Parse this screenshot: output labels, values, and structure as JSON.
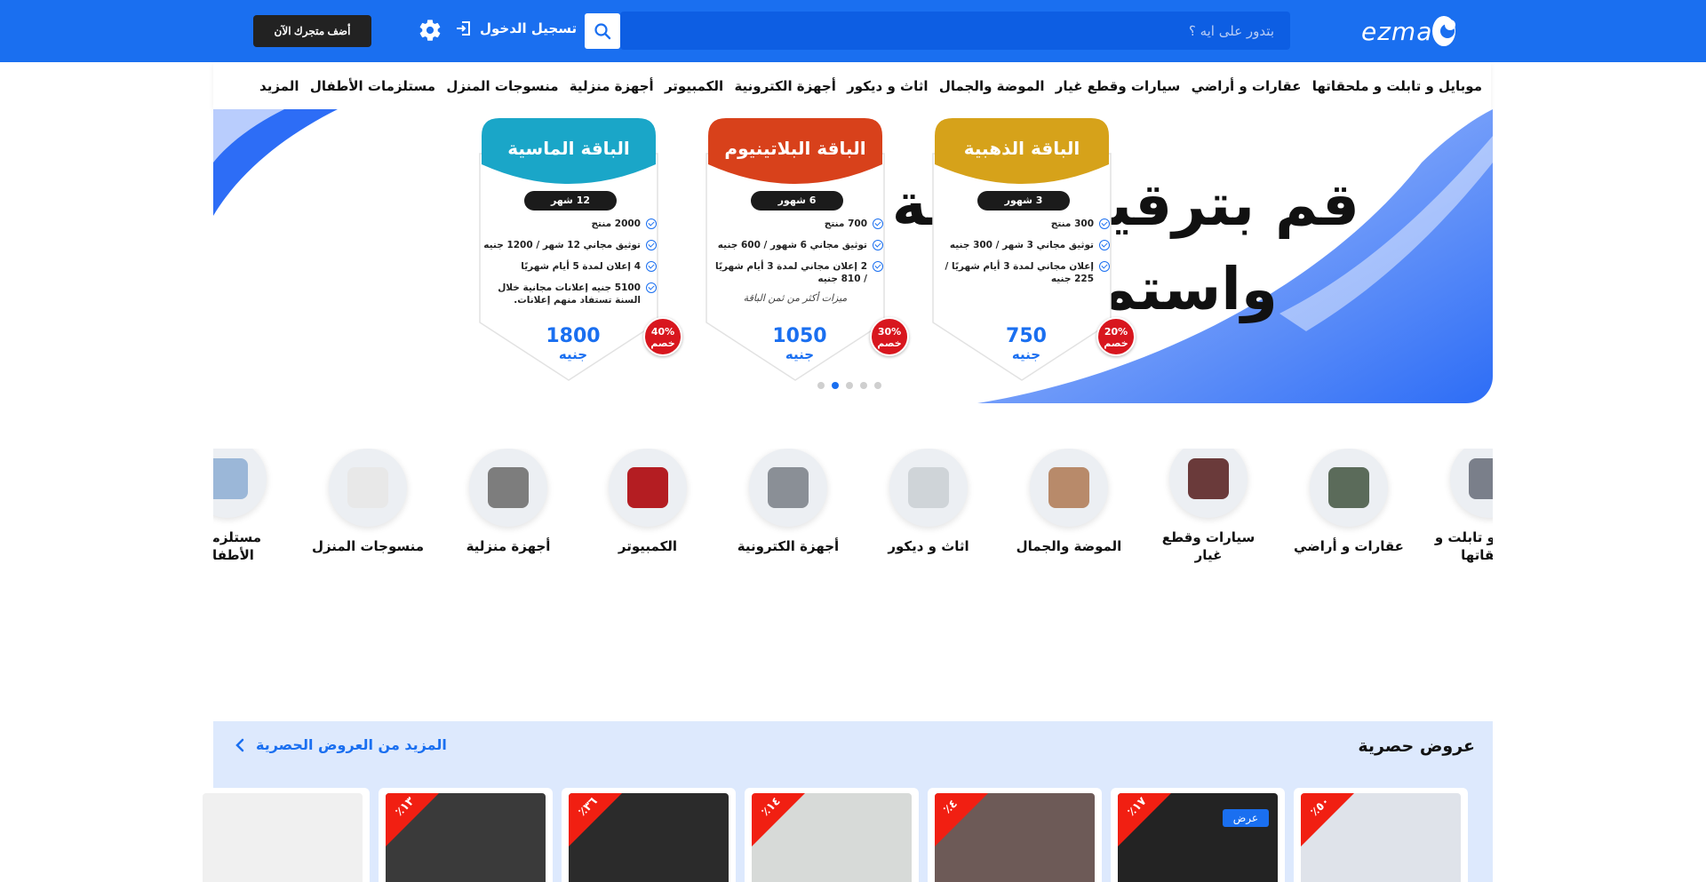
{
  "header": {
    "logo_text": "ezma",
    "search_placeholder": "بتدور على ايه ؟",
    "login_label": "تسجيل الدخول",
    "add_store_label": "أضف متجرك الآن"
  },
  "nav": {
    "items": [
      "موبايل و تابلت و ملحقاتها",
      "عقارات و أراضي",
      "سيارات وقطع غيار",
      "الموضة والجمال",
      "اثاث و ديكور",
      "أجهزة الكترونية",
      "الكمبيوتر",
      "أجهزة منزلية",
      "منسوجات المنزل",
      "مستلزمات الأطفال",
      "المزيد"
    ]
  },
  "banner": {
    "headline_line1": "قم بترقية الباقة",
    "headline_line2": "واستمتع بـ",
    "packages": [
      {
        "title": "الباقة الذهبية",
        "duration": "3 شهور",
        "features": [
          "300 منتج",
          "توثيق مجاني 3 شهر / 300 جنيه",
          "إعلان مجاني لمدة 3 أيام شهريًا / 225 جنيه"
        ],
        "note": "",
        "price": "750",
        "currency": "جنيه",
        "discount": "20%",
        "discount_word": "خصم",
        "color": "#d6a21a"
      },
      {
        "title": "الباقة البلاتينيوم",
        "duration": "6 شهور",
        "features": [
          "700 منتج",
          "توثيق مجاني 6 شهور / 600 جنيه",
          "2 إعلان مجاني لمدة 3 أيام شهريًا / 810 جنيه"
        ],
        "note": "ميزات أكثر من ثمن الباقة",
        "price": "1050",
        "currency": "جنيه",
        "discount": "30%",
        "discount_word": "خصم",
        "color": "#d8411b"
      },
      {
        "title": "الباقة الماسية",
        "duration": "12 شهر",
        "features": [
          "2000 منتج",
          "توثيق مجاني 12 شهر / 1200 جنيه",
          "4 إعلان لمدة 5 أيام شهريًا",
          "5100 جنيه إعلانات مجانية خلال السنة تستفاد منهم إعلانات."
        ],
        "note": "",
        "price": "1800",
        "currency": "جنيه",
        "discount": "40%",
        "discount_word": "خصم",
        "color": "#1aa6c8"
      }
    ],
    "slide_count": 5,
    "active_slide": 2
  },
  "categories": [
    {
      "label": "موبايل و تابلت و ملحقاتها",
      "icon": "phone-accessories-icon"
    },
    {
      "label": "عقارات و أراضي",
      "icon": "house-icon"
    },
    {
      "label": "سيارات وقطع غيار",
      "icon": "car-parts-icon"
    },
    {
      "label": "الموضة والجمال",
      "icon": "cosmetics-icon"
    },
    {
      "label": "اثاث و ديكور",
      "icon": "furniture-icon"
    },
    {
      "label": "أجهزة الكترونية",
      "icon": "electronics-icon"
    },
    {
      "label": "الكمبيوتر",
      "icon": "computer-icon"
    },
    {
      "label": "أجهزة منزلية",
      "icon": "appliances-icon"
    },
    {
      "label": "منسوجات المنزل",
      "icon": "pillows-icon"
    },
    {
      "label": "مستلزمات الأطفال",
      "icon": "stroller-icon"
    }
  ],
  "offers": {
    "title": "عروض حصرية",
    "more_label": "المزيد من العروض الحصرية",
    "products": [
      {
        "discount": "٥٠٪",
        "offer_tag": "",
        "bg": "#dfe3ea"
      },
      {
        "discount": "١٧٪",
        "offer_tag": "عرض",
        "bg": "#232323"
      },
      {
        "discount": "٤٪",
        "offer_tag": "",
        "bg": "#6d5a57"
      },
      {
        "discount": "١٤٪",
        "offer_tag": "",
        "bg": "#d7dad8"
      },
      {
        "discount": "٣٦٪",
        "offer_tag": "",
        "bg": "#2b2b2b"
      },
      {
        "discount": "١٣٪",
        "offer_tag": "",
        "bg": "#3a3a3a"
      },
      {
        "discount": "",
        "offer_tag": "",
        "bg": "#f0f0f0"
      }
    ]
  },
  "colors": {
    "brand_blue": "#1a6ff0",
    "offers_bg": "#dde9fd",
    "discount_red": "#f11f12"
  }
}
